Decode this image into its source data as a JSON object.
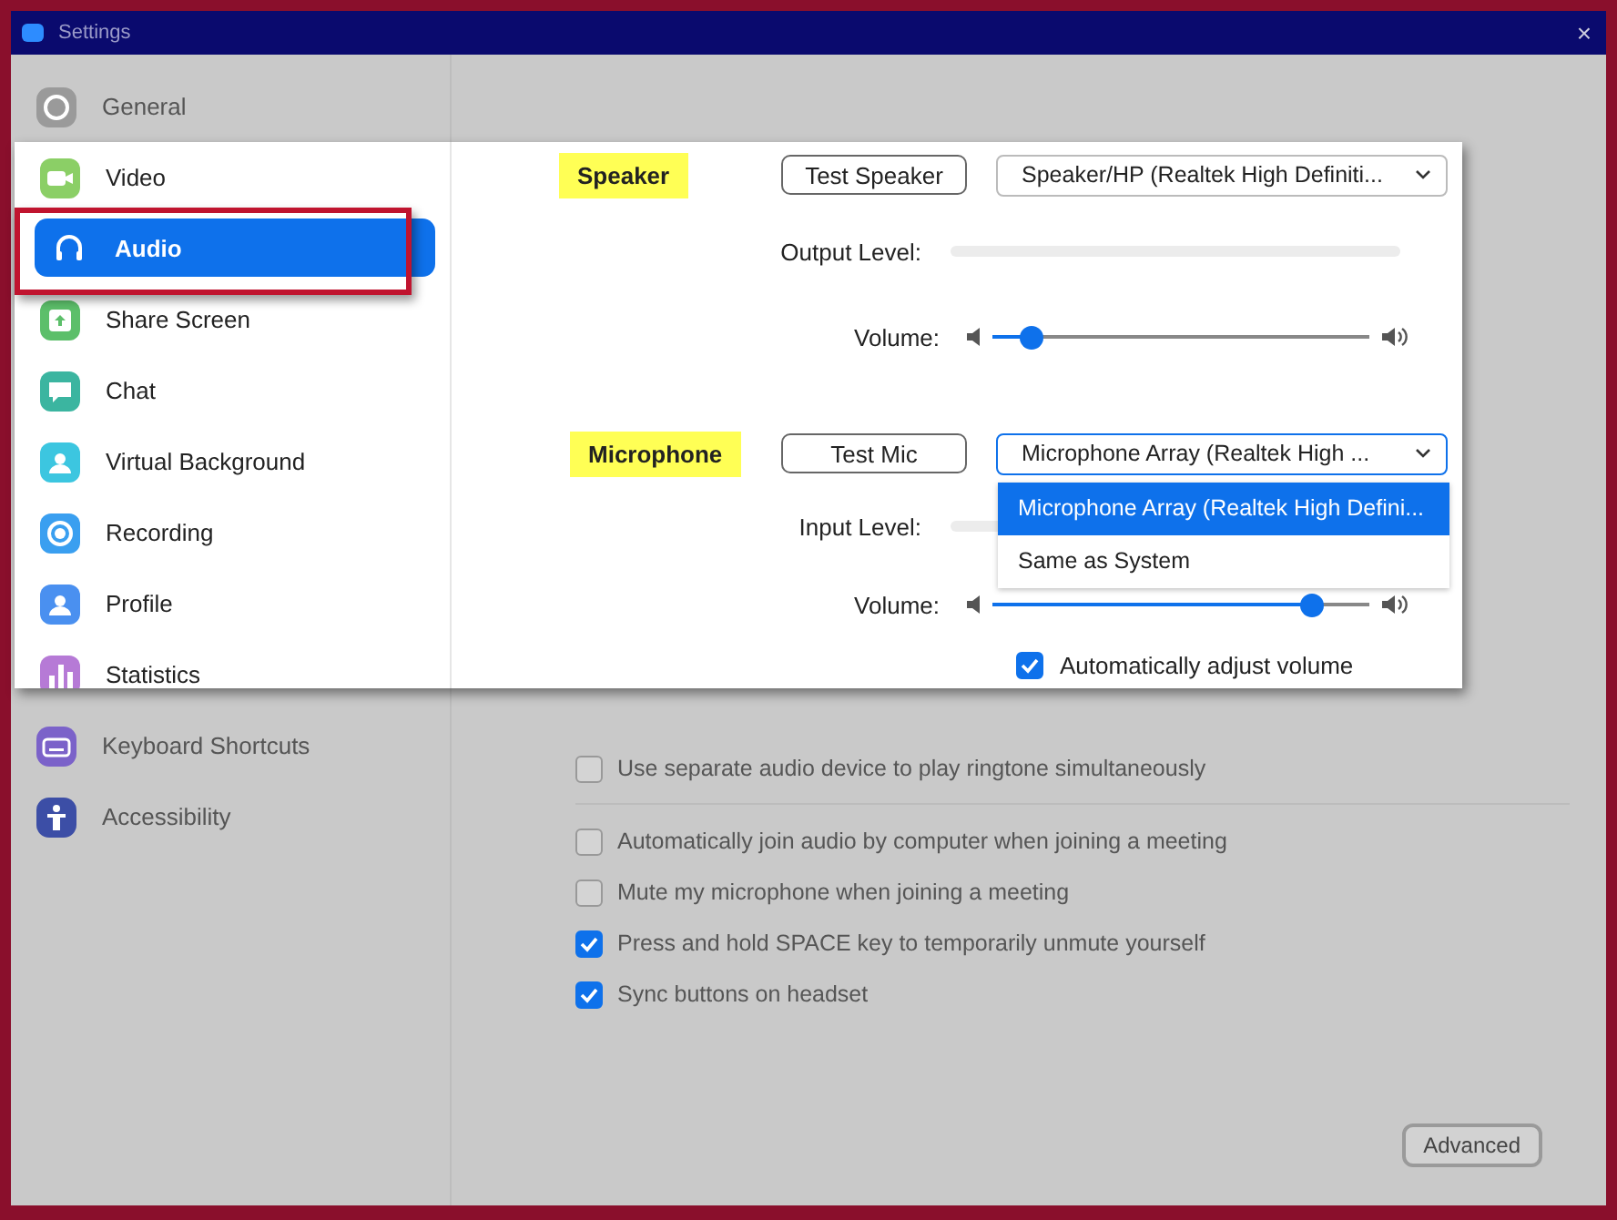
{
  "window": {
    "title": "Settings",
    "close": "×"
  },
  "sidebar": {
    "items": [
      {
        "label": "General",
        "kind": "gear",
        "color": "#9a9a9a",
        "selected": false,
        "dimmed": true
      },
      {
        "label": "Video",
        "kind": "camera",
        "color": "#8bcf66",
        "selected": false,
        "dimmed": false
      },
      {
        "label": "Audio",
        "kind": "headphones",
        "selected": true,
        "dimmed": false
      },
      {
        "label": "Share Screen",
        "kind": "share",
        "color": "#5cbf6a",
        "selected": false,
        "dimmed": false
      },
      {
        "label": "Chat",
        "kind": "chat",
        "color": "#3bb5a0",
        "selected": false,
        "dimmed": false
      },
      {
        "label": "Virtual Background",
        "kind": "person",
        "color": "#3cc6e0",
        "selected": false,
        "dimmed": false
      },
      {
        "label": "Recording",
        "kind": "record",
        "color": "#3a9ff0",
        "selected": false,
        "dimmed": false
      },
      {
        "label": "Profile",
        "kind": "person",
        "color": "#4a90f0",
        "selected": false,
        "dimmed": false
      },
      {
        "label": "Statistics",
        "kind": "bars",
        "color": "#b67ad6",
        "selected": false,
        "dimmed": false
      },
      {
        "label": "Keyboard Shortcuts",
        "kind": "keyboard",
        "color": "#7b62c9",
        "selected": false,
        "dimmed": true
      },
      {
        "label": "Accessibility",
        "kind": "figure",
        "color": "#3c4ea6",
        "selected": false,
        "dimmed": true
      }
    ]
  },
  "speaker": {
    "heading": "Speaker",
    "test_button": "Test Speaker",
    "device": "Speaker/HP (Realtek High Definiti...",
    "output_label": "Output Level:",
    "output_meter": {
      "level": 0
    },
    "volume_label": "Volume:",
    "volume": {
      "level": 0.1
    }
  },
  "microphone": {
    "heading": "Microphone",
    "test_button": "Test Mic",
    "device": "Microphone Array (Realtek High ...",
    "expanded": true,
    "options": [
      {
        "label": "Microphone Array (Realtek High Defini...",
        "selected": true
      },
      {
        "label": "Same as System",
        "selected": false
      }
    ],
    "input_label": "Input Level:",
    "input_meter": {
      "level": 0
    },
    "volume_label": "Volume:",
    "volume": {
      "level": 0.845
    },
    "auto_adjust": {
      "label": "Automatically adjust volume",
      "checked": true
    }
  },
  "options": [
    {
      "label": "Use separate audio device to play ringtone simultaneously",
      "checked": false
    },
    {
      "label": "Automatically join audio by computer when joining a meeting",
      "checked": false
    },
    {
      "label": "Mute my microphone when joining a meeting",
      "checked": false
    },
    {
      "label": "Press and hold SPACE key to temporarily unmute yourself",
      "checked": true
    },
    {
      "label": "Sync buttons on headset",
      "checked": true
    }
  ],
  "advanced_button": "Advanced"
}
